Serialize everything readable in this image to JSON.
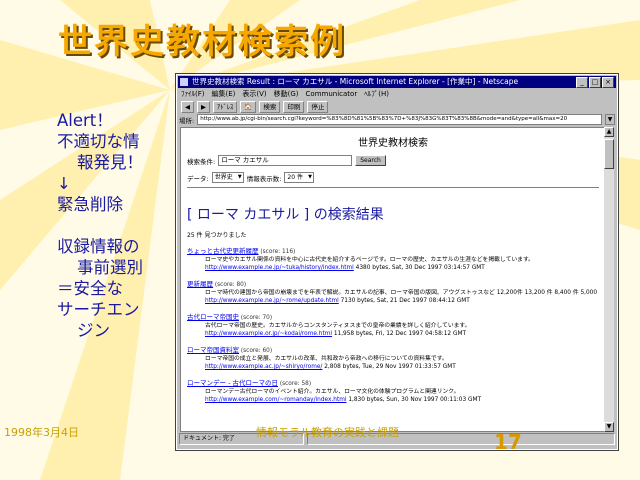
{
  "slide": {
    "title": "世界史教材検索例",
    "bullets": [
      {
        "text": "Alert！",
        "indent": false
      },
      {
        "text": "不適切な情",
        "indent": false
      },
      {
        "text": "報発見！",
        "indent": true
      },
      {
        "text": "↓",
        "indent": false
      },
      {
        "text": "緊急削除",
        "indent": false
      },
      {
        "text": "",
        "indent": false
      },
      {
        "text": "収録情報の",
        "indent": false
      },
      {
        "text": "事前選別",
        "indent": true
      },
      {
        "text": "＝安全な",
        "indent": false
      },
      {
        "text": "サーチエン",
        "indent": false
      },
      {
        "text": "ジン",
        "indent": true
      }
    ],
    "footer_date": "1998年3月4日",
    "footer_center": "情報モラル教育の実践と課題",
    "page_number": "17"
  },
  "browser": {
    "title": "世界史教材検索 Result : ローマ カエサル - Microsoft Internet Explorer - [作業中] - Netscape",
    "menu": [
      "ﾌｧｲﾙ(F)",
      "編集(E)",
      "表示(V)",
      "移動(G)",
      "Communicator",
      "ﾍﾙﾌﾟ(H)"
    ],
    "toolbar": [
      "◀",
      "▶",
      "ｱﾄﾞﾚｽ",
      "🏠",
      "検索",
      "印刷",
      "停止"
    ],
    "address_label": "場所:",
    "url": "http://www.ab.jp/cgi-bin/search.cgi?keyword=%83%8D%81%5B%83%7D+%83J%83G%83T%83%8B&mode=and&type=all&max=20",
    "status_left": "ドキュメント: 完了",
    "status_right": ""
  },
  "page": {
    "heading": "世界史教材検索",
    "search_label": "検索条件:",
    "search_value": "ローマ カエサル",
    "search_button": "Search",
    "data_label": "データ:",
    "data_select": "世界史",
    "info_label": "情報表示数:",
    "info_select": "20 件",
    "results_heading": "[ ローマ カエサル ] の検索結果",
    "results_count": "25 件 見つかりました",
    "results": [
      {
        "title": "ちょっと古代史更新履歴",
        "score": "(score: 116)",
        "desc": "ローマ史やカエサル関係の資料を中心に古代史を紹介するページです。ローマの歴史、カエサルの生涯などを掲載しています。",
        "link": "http://www.example.ne.jp/~tuka/history/index.html",
        "meta": "4380 bytes, Sat, 30 Dec 1997 03:14:57 GMT"
      },
      {
        "title": "更新履歴",
        "score": "(score: 80)",
        "desc": "ローマ時代の建国から帝国の崩壊までを年表で解説。カエサルの記事、ローマ帝国の版図、アウグストゥスなど 12,200件 13,200 件 8,400 件 5,000...",
        "link": "http://www.example.ne.jp/~rome/update.html",
        "meta": "7130 bytes, Sat, 21 Dec 1997 08:44:12 GMT"
      },
      {
        "title": "古代ローマ帝国史",
        "score": "(score: 70)",
        "desc": "古代ローマ帝国の歴史。カエサルからコンスタンティヌスまでの皇帝の業績を詳しく紹介しています。",
        "link": "http://www.example.or.jp/~kodai/rome.html",
        "meta": "11,958 bytes, Fri, 12 Dec 1997 04:58:12 GMT"
      },
      {
        "title": "ローマ帝国資料室",
        "score": "(score: 60)",
        "desc": "ローマ帝国の成立と発展、カエサルの改革、共和政から帝政への移行についての資料集です。",
        "link": "http://www.example.ac.jp/~shiryo/rome/",
        "meta": "2,808 bytes, Tue, 29 Nov 1997 01:33:57 GMT"
      },
      {
        "title": "ローマンデー - 古代ローマの日",
        "score": "(score: 58)",
        "desc": "ローマンデー古代ローマのイベント紹介。カエサル、ローマ文化の体験プログラムと関連リンク。",
        "link": "http://www.example.com/~romanday/index.html",
        "meta": "1,830 bytes, Sun, 30 Nov 1997 00:11:03 GMT"
      }
    ]
  }
}
